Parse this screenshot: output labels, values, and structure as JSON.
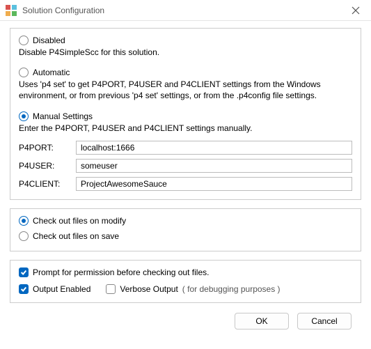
{
  "window": {
    "title": "Solution Configuration"
  },
  "options": {
    "disabled": {
      "label": "Disabled",
      "desc": "Disable P4SimpleScc for this solution.",
      "checked": false
    },
    "automatic": {
      "label": "Automatic",
      "desc": "Uses 'p4 set' to get P4PORT, P4USER and P4CLIENT settings from the Windows environment, or from previous 'p4 set' settings, or from the .p4config file settings.",
      "checked": false
    },
    "manual": {
      "label": "Manual Settings",
      "desc": "Enter the P4PORT, P4USER and P4CLIENT settings manually.",
      "checked": true
    }
  },
  "fields": {
    "p4port": {
      "label": "P4PORT:",
      "value": "localhost:1666"
    },
    "p4user": {
      "label": "P4USER:",
      "value": "someuser"
    },
    "p4client": {
      "label": "P4CLIENT:",
      "value": "ProjectAwesomeSauce"
    }
  },
  "checkout": {
    "on_modify": {
      "label": "Check out files on modify",
      "checked": true
    },
    "on_save": {
      "label": "Check out files on save",
      "checked": false
    }
  },
  "checks": {
    "prompt": {
      "label": "Prompt for permission before checking out files.",
      "checked": true
    },
    "output_enabled": {
      "label": "Output Enabled",
      "checked": true
    },
    "verbose": {
      "label": "Verbose Output",
      "hint": "( for debugging purposes )",
      "checked": false
    }
  },
  "buttons": {
    "ok": "OK",
    "cancel": "Cancel"
  }
}
